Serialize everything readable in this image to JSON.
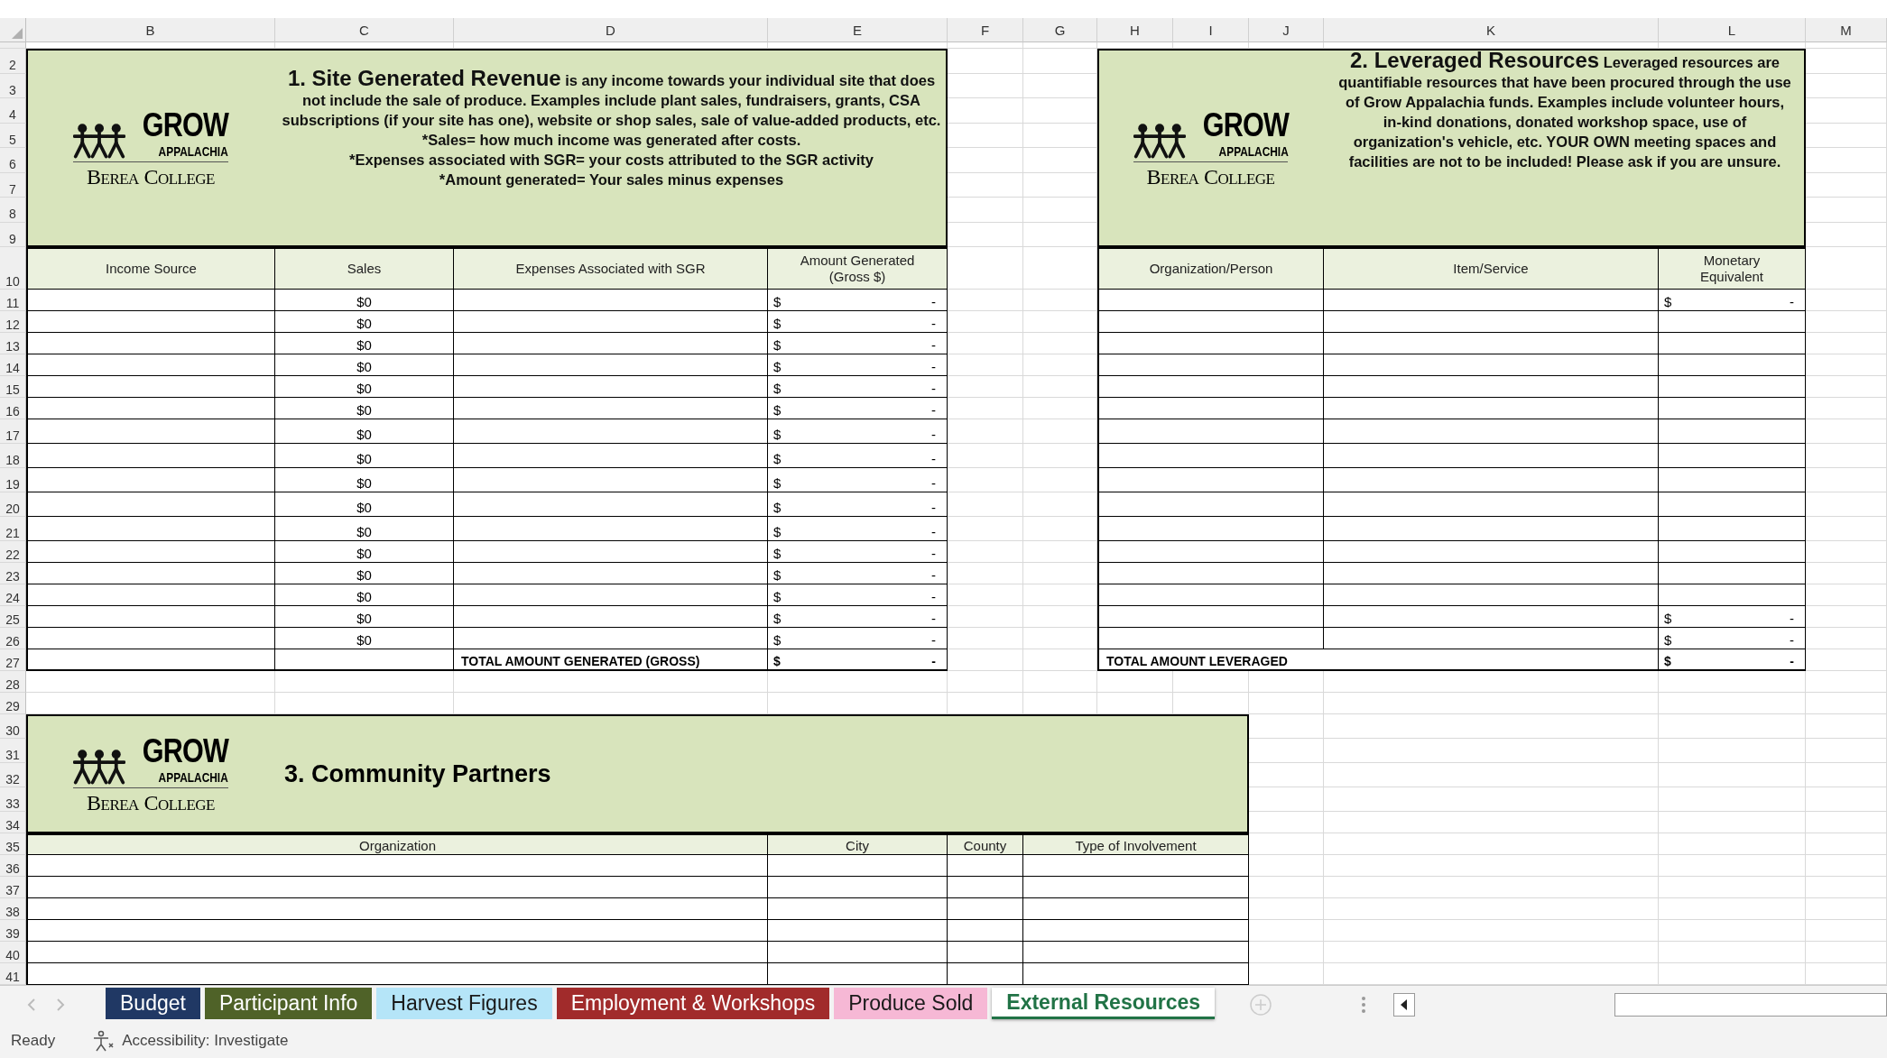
{
  "column_headers": [
    "B",
    "C",
    "D",
    "E",
    "F",
    "G",
    "H",
    "I",
    "J",
    "K",
    "L",
    "M"
  ],
  "row_numbers": [
    "2",
    "3",
    "4",
    "5",
    "6",
    "7",
    "8",
    "9",
    "10",
    "11",
    "12",
    "13",
    "14",
    "15",
    "16",
    "17",
    "18",
    "19",
    "20",
    "21",
    "22",
    "23",
    "24",
    "25",
    "26",
    "27",
    "28",
    "29",
    "30",
    "31",
    "32",
    "33",
    "34",
    "35",
    "36",
    "37",
    "38",
    "39",
    "40",
    "41"
  ],
  "revenue": {
    "logo": {
      "name": "GROW",
      "subname": "APPALACHIA",
      "college": "Berea College"
    },
    "description": "**1. Site Generated Revenue** is any income towards your individual site that does not include the sale of produce. Examples include plant sales, fundraisers, grants, CSA subscriptions (if your site has one),  website or shop sales, sale of value-added products, etc.",
    "notes": [
      "*Sales= how much income was generated after costs.",
      "*Expenses associated with SGR= your costs attributed to the SGR activity",
      "*Amount generated= Your sales minus expenses"
    ],
    "columns": [
      "Income Source",
      "Sales",
      "Expenses Associated with SGR",
      "Amount Generated (Gross $)"
    ],
    "rows": [
      {
        "sales": "$0",
        "symbol": "$",
        "amount": "-"
      },
      {
        "sales": "$0",
        "symbol": "$",
        "amount": "-"
      },
      {
        "sales": "$0",
        "symbol": "$",
        "amount": "-"
      },
      {
        "sales": "$0",
        "symbol": "$",
        "amount": "-"
      },
      {
        "sales": "$0",
        "symbol": "$",
        "amount": "-"
      },
      {
        "sales": "$0",
        "symbol": "$",
        "amount": "-"
      },
      {
        "sales": "$0",
        "symbol": "$",
        "amount": "-"
      },
      {
        "sales": "$0",
        "symbol": "$",
        "amount": "-"
      },
      {
        "sales": "$0",
        "symbol": "$",
        "amount": "-"
      },
      {
        "sales": "$0",
        "symbol": "$",
        "amount": "-"
      },
      {
        "sales": "$0",
        "symbol": "$",
        "amount": "-"
      },
      {
        "sales": "$0",
        "symbol": "$",
        "amount": "-"
      },
      {
        "sales": "$0",
        "symbol": "$",
        "amount": "-"
      },
      {
        "sales": "$0",
        "symbol": "$",
        "amount": "-"
      },
      {
        "sales": "$0",
        "symbol": "$",
        "amount": "-"
      },
      {
        "sales": "$0",
        "symbol": "$",
        "amount": "-"
      }
    ],
    "total": {
      "label": "TOTAL AMOUNT GENERATED (GROSS)",
      "symbol": "$",
      "amount": "-"
    }
  },
  "leveraged": {
    "logo": {
      "name": "GROW",
      "subname": "APPALACHIA",
      "college": "Berea College"
    },
    "description": "**2. Leveraged Resources** Leveraged resources are quantifiable resources that have been procured through the use of Grow Appalachia funds. Examples include volunteer hours, in-kind donations, donated workshop space, use of organization's vehicle, etc. YOUR OWN meeting spaces and facilities are not to be included! Please ask if you are unsure.",
    "columns": [
      "Organization/Person",
      "Item/Service",
      "Monetary Equivalent"
    ],
    "rows": [
      {
        "symbol": "$",
        "amount": "-"
      },
      {},
      {},
      {},
      {},
      {},
      {},
      {},
      {},
      {},
      {},
      {},
      {},
      {},
      {
        "symbol": "$",
        "amount": "-"
      },
      {
        "symbol": "$",
        "amount": "-"
      }
    ],
    "total": {
      "label": "TOTAL AMOUNT LEVERAGED",
      "symbol": "$",
      "amount": "-"
    }
  },
  "community": {
    "logo": {
      "name": "GROW",
      "subname": "APPALACHIA",
      "college": "Berea College"
    },
    "title": "3. Community Partners",
    "columns": [
      "Organization",
      "City",
      "County",
      "Type of Involvement"
    ],
    "rows": [
      {},
      {},
      {},
      {},
      {},
      {}
    ]
  },
  "sheet_tabs": [
    {
      "label": "Budget",
      "color": "#203864",
      "selected": false
    },
    {
      "label": "Participant Info",
      "color": "#4f6228",
      "selected": false
    },
    {
      "label": "Harvest Figures",
      "color": "#b5e5f8",
      "selected": false
    },
    {
      "label": "Employment & Workshops",
      "color": "#a12b2b",
      "selected": false
    },
    {
      "label": "Produce Sold",
      "color": "#f6b8d5",
      "selected": false
    },
    {
      "label": "External Resources",
      "color": "#217346",
      "selected": true
    }
  ],
  "status_bar": {
    "state": "Ready",
    "accessibility": "Accessibility: Investigate"
  }
}
